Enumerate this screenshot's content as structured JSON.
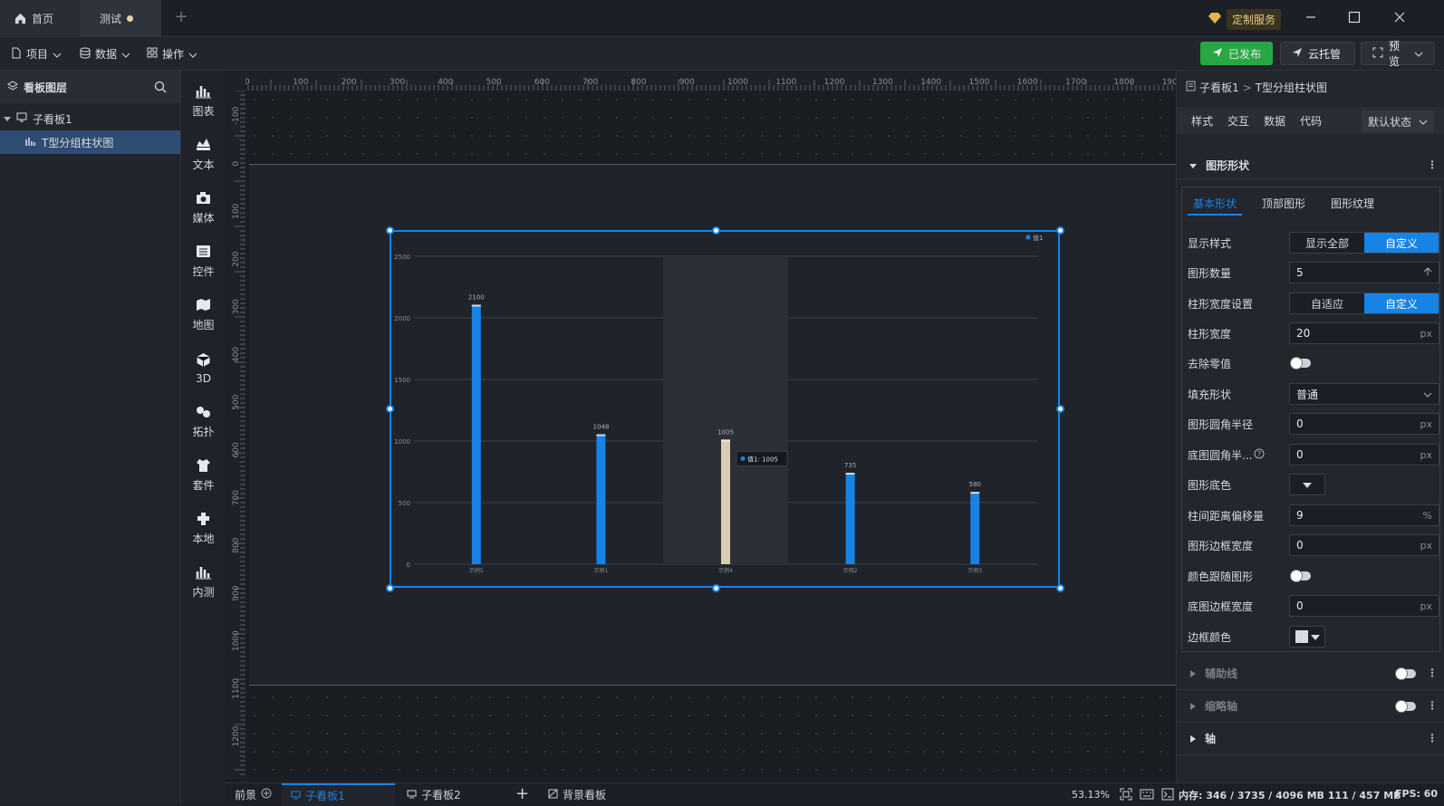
{
  "titlebar": {
    "home_tab": "首页",
    "doc_tab": "测试",
    "custom_service": "定制服务"
  },
  "toolbar": {
    "project": "项目",
    "data": "数据",
    "operation": "操作",
    "published": "已发布",
    "cloud_host": "云托管",
    "preview": "预览"
  },
  "layers": {
    "title": "看板图层",
    "tree": [
      {
        "label": "子看板1"
      },
      {
        "label": "T型分组柱状图"
      }
    ]
  },
  "components": [
    "图表",
    "文本",
    "媒体",
    "控件",
    "地图",
    "3D",
    "拓扑",
    "套件",
    "本地",
    "内测"
  ],
  "rulers": {
    "h": [
      "0",
      "100",
      "200",
      "300",
      "400",
      "500",
      "600",
      "700",
      "800",
      "900",
      "1000",
      "1100",
      "1200",
      "1300",
      "1400",
      "1500",
      "1600",
      "1700",
      "1800",
      "1900"
    ],
    "v": [
      "-100",
      "0",
      "100",
      "200",
      "300",
      "400",
      "500",
      "600",
      "700",
      "800",
      "900",
      "1000",
      "1100",
      "1200"
    ]
  },
  "chart_data": {
    "type": "bar",
    "categories": [
      "示例5",
      "示例1",
      "示例4",
      "示例2",
      "示例3"
    ],
    "series": [
      {
        "name": "值1",
        "values": [
          2100,
          1048,
          1005,
          735,
          580
        ]
      }
    ],
    "ylim": [
      0,
      2500
    ],
    "yticks": [
      "0",
      "500",
      "1000",
      "1500",
      "2000",
      "2500"
    ],
    "highlight_index": 2,
    "highlight_color": "#d8ccb0",
    "bar_color": "#1784e5",
    "tooltip": {
      "label": "值1:",
      "value": "1005"
    },
    "legend_placement": "top-right",
    "grid": true
  },
  "right_panel": {
    "breadcrumb_parent": "子看板1",
    "breadcrumb_current": "T型分组柱状图",
    "tabs": [
      "样式",
      "交互",
      "数据",
      "代码"
    ],
    "state_select": "默认状态",
    "section_title": "图形形状",
    "subtabs": [
      "基本形状",
      "顶部图形",
      "图形纹理"
    ],
    "props": {
      "display_style_label": "显示样式",
      "display_all": "显示全部",
      "custom": "自定义",
      "count_label": "图形数量",
      "count_value": "5",
      "bar_width_setting_label": "柱形宽度设置",
      "adaptive": "自适应",
      "bar_width_label": "柱形宽度",
      "bar_width_value": "20",
      "remove_zero_label": "去除零值",
      "fill_shape_label": "填充形状",
      "fill_shape_value": "普通",
      "radius_label": "图形圆角半径",
      "radius_value": "0",
      "bg_radius_label": "底图圆角半...",
      "bg_radius_value": "0",
      "fill_color_label": "图形底色",
      "offset_label": "柱间距离偏移量",
      "offset_value": "9",
      "border_width_label": "图形边框宽度",
      "border_width_value": "0",
      "follow_color_label": "颜色跟随图形",
      "bg_border_label": "底图边框宽度",
      "bg_border_value": "0",
      "border_color_label": "边框颜色",
      "unit_px": "px",
      "unit_pct": "%"
    },
    "collapsed_sections": [
      "辅助线",
      "缩略轴",
      "轴"
    ]
  },
  "bottom": {
    "foreground": "前景",
    "board1": "子看板1",
    "board2": "子看板2",
    "background_board": "背景看板",
    "zoom": "53.13%"
  },
  "status": {
    "memory": "内存:  346 / 3735 / 4096 MB  111 / 457 MB",
    "fps": "FPS:  60"
  }
}
